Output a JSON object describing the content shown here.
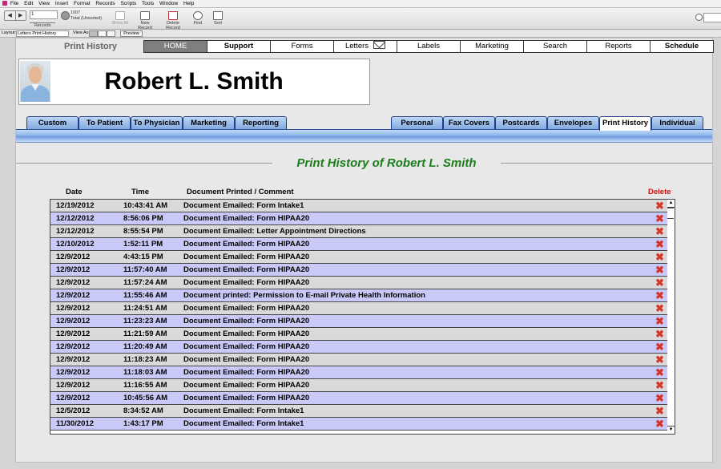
{
  "menu": [
    "File",
    "Edit",
    "View",
    "Insert",
    "Format",
    "Records",
    "Scripts",
    "Tools",
    "Window",
    "Help"
  ],
  "toolbar": {
    "record_value": "1",
    "records_label": "Records",
    "record_count": "1007",
    "record_total": "Total (Unsorted)",
    "show_all": "Show All",
    "new_record": "New Record",
    "delete_record": "Delete Record",
    "find": "Find",
    "sort": "Sort"
  },
  "layoutbar": {
    "layout_label": "Layout:",
    "layout_value": "Letters Print History",
    "view_as": "View As:",
    "preview": "Preview"
  },
  "page": {
    "print_history_title": "Print History",
    "top_nav": [
      "HOME",
      "Support",
      "Forms",
      "Letters",
      "Labels",
      "Marketing",
      "Search",
      "Reports",
      "Schedule"
    ],
    "patient_name": "Robert L. Smith",
    "left_tabs": [
      "Custom",
      "To Patient",
      "To Physician",
      "Marketing",
      "Reporting"
    ],
    "right_tabs": [
      "Personal",
      "Fax Covers",
      "Postcards",
      "Envelopes",
      "Print History",
      "Individual"
    ],
    "active_tab": "Print History",
    "section_title": "Print History of Robert L. Smith"
  },
  "table": {
    "headers": {
      "date": "Date",
      "time": "Time",
      "document": "Document Printed / Comment",
      "delete": "Delete"
    },
    "rows": [
      {
        "date": "12/19/2012",
        "time": "10:43:41 AM",
        "doc": "Document Emailed: Form Intake1"
      },
      {
        "date": "12/12/2012",
        "time": "8:56:06 PM",
        "doc": "Document Emailed: Form HIPAA20"
      },
      {
        "date": "12/12/2012",
        "time": "8:55:54 PM",
        "doc": "Document Emailed: Letter Appointment Directions"
      },
      {
        "date": "12/10/2012",
        "time": "1:52:11 PM",
        "doc": "Document Emailed: Form HIPAA20"
      },
      {
        "date": "12/9/2012",
        "time": "4:43:15 PM",
        "doc": "Document Emailed: Form HIPAA20"
      },
      {
        "date": "12/9/2012",
        "time": "11:57:40 AM",
        "doc": "Document Emailed: Form HIPAA20"
      },
      {
        "date": "12/9/2012",
        "time": "11:57:24 AM",
        "doc": "Document Emailed: Form HIPAA20"
      },
      {
        "date": "12/9/2012",
        "time": "11:55:46 AM",
        "doc": "Document printed: Permission to E-mail Private Health Information"
      },
      {
        "date": "12/9/2012",
        "time": "11:24:51 AM",
        "doc": "Document Emailed: Form HIPAA20"
      },
      {
        "date": "12/9/2012",
        "time": "11:23:23 AM",
        "doc": "Document Emailed: Form HIPAA20"
      },
      {
        "date": "12/9/2012",
        "time": "11:21:59 AM",
        "doc": "Document Emailed: Form HIPAA20"
      },
      {
        "date": "12/9/2012",
        "time": "11:20:49 AM",
        "doc": "Document Emailed: Form HIPAA20"
      },
      {
        "date": "12/9/2012",
        "time": "11:18:23 AM",
        "doc": "Document Emailed: Form HIPAA20"
      },
      {
        "date": "12/9/2012",
        "time": "11:18:03 AM",
        "doc": "Document Emailed: Form HIPAA20"
      },
      {
        "date": "12/9/2012",
        "time": "11:16:55 AM",
        "doc": "Document Emailed: Form HIPAA20"
      },
      {
        "date": "12/9/2012",
        "time": "10:45:56 AM",
        "doc": "Document Emailed: Form HIPAA20"
      },
      {
        "date": "12/5/2012",
        "time": "8:34:52 AM",
        "doc": "Document Emailed: Form Intake1"
      },
      {
        "date": "11/30/2012",
        "time": "1:43:17 PM",
        "doc": "Document Emailed: Form Intake1"
      }
    ]
  },
  "icons": {
    "delete": "close-icon",
    "envelope": "envelope-icon",
    "search": "search-icon"
  },
  "colors": {
    "accent_title": "#1b7d1b",
    "delete_header": "#cc1111",
    "delete_x": "#d8362b",
    "row_alt": "#c9c9f7",
    "tab_blue": "#7fa6dd",
    "home_tab": "#7f7f7f"
  }
}
